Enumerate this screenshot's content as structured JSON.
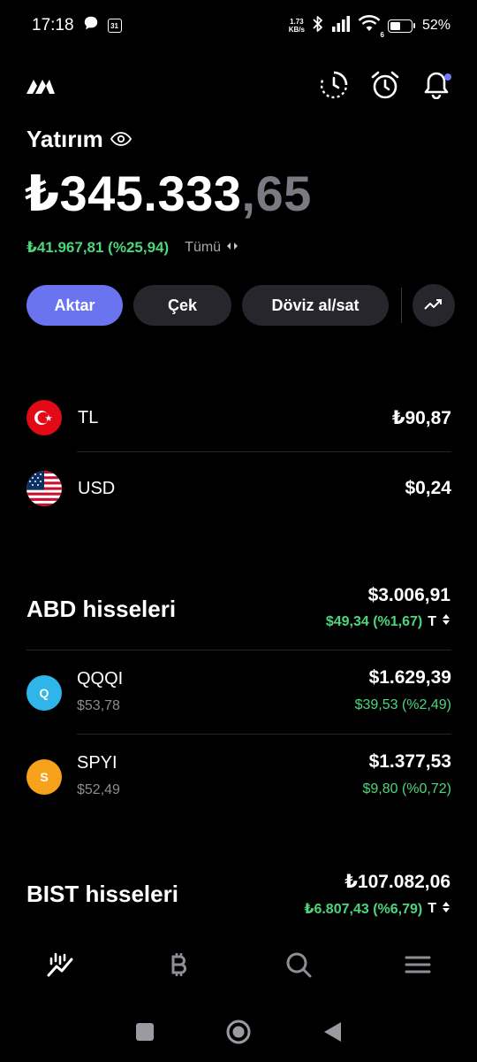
{
  "status_bar": {
    "time": "17:18",
    "calendar_day": "31",
    "net_speed_value": "1.73",
    "net_speed_unit": "KB/s",
    "wifi_label": "6",
    "battery": "52%",
    "battery_level": 0.52
  },
  "portfolio": {
    "title": "Yatırım",
    "balance_main": "₺345.333",
    "balance_decimal": ",65",
    "gain": "₺41.967,81 (%25,94)",
    "period": "Tümü"
  },
  "actions": {
    "transfer": "Aktar",
    "withdraw": "Çek",
    "fx": "Döviz al/sat"
  },
  "currencies": [
    {
      "code": "TL",
      "value": "₺90,87"
    },
    {
      "code": "USD",
      "value": "$0,24"
    }
  ],
  "us_stocks": {
    "title": "ABD hisseleri",
    "total": "$3.006,91",
    "change": "$49,34 (%1,67)",
    "currency_toggle": "T",
    "items": [
      {
        "initial": "Q",
        "symbol": "QQQI",
        "price": "$53,78",
        "value": "$1.629,39",
        "change": "$39,53 (%2,49)",
        "color": "#2fb5ea"
      },
      {
        "initial": "S",
        "symbol": "SPYI",
        "price": "$52,49",
        "value": "$1.377,53",
        "change": "$9,80 (%0,72)",
        "color": "#f7a21b"
      }
    ]
  },
  "bist_stocks": {
    "title": "BIST hisseleri",
    "total": "₺107.082,06",
    "change": "₺6.807,43 (%6,79)",
    "currency_toggle": "T"
  },
  "colors": {
    "accent": "#6b74f0",
    "positive": "#4cd67c",
    "button_bg": "#26262c",
    "notification_dot": "#6d7cff"
  },
  "icons": {
    "header": [
      "history-icon",
      "alarm-icon",
      "bell-icon"
    ],
    "bottom_nav": [
      "portfolio-chart-icon",
      "bitcoin-icon",
      "search-icon",
      "menu-icon"
    ],
    "system_nav": [
      "recents-icon",
      "home-icon",
      "back-icon"
    ]
  }
}
